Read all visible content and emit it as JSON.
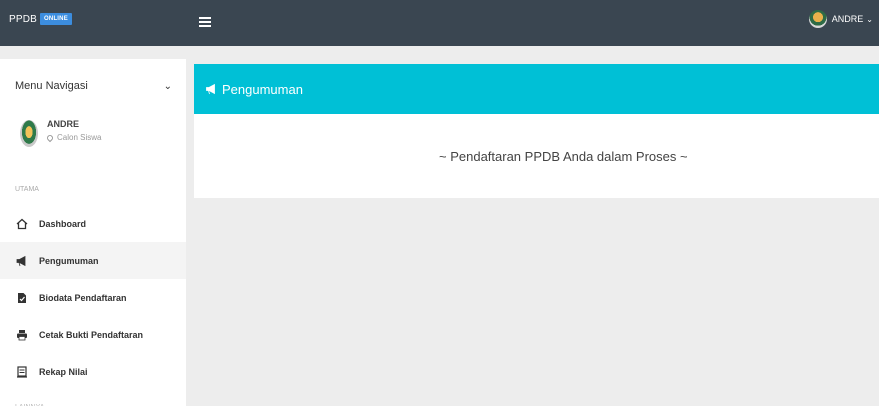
{
  "topbar": {
    "brand": "PPDB",
    "badge": "ONLINE",
    "user_name": "ANDRE"
  },
  "sidebar": {
    "menu_title": "Menu Navigasi",
    "profile": {
      "name": "ANDRE",
      "role": "Calon Siswa"
    },
    "section_main": "UTAMA",
    "items": [
      {
        "label": "Dashboard",
        "icon": "home-icon"
      },
      {
        "label": "Pengumuman",
        "icon": "megaphone-icon",
        "active": true
      },
      {
        "label": "Biodata Pendaftaran",
        "icon": "file-check-icon"
      },
      {
        "label": "Cetak Bukti Pendaftaran",
        "icon": "printer-icon"
      },
      {
        "label": "Rekap Nilai",
        "icon": "list-icon"
      }
    ],
    "section_other": "LAINNYA"
  },
  "main": {
    "panel_title": "Pengumuman",
    "message": "~ Pendaftaran PPDB Anda dalam Proses ~"
  },
  "colors": {
    "topbar": "#3a4651",
    "accent": "#00c0d6",
    "badge": "#3c8dde"
  }
}
